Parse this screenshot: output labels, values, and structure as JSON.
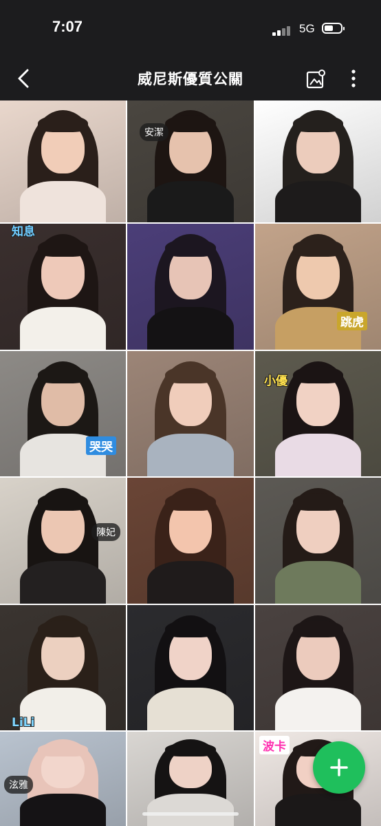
{
  "status_bar": {
    "time": "7:07",
    "network": "5G"
  },
  "header": {
    "title": "威尼斯優質公關",
    "back_icon": "chevron-left-icon",
    "album_icon": "photo-album-icon",
    "more_icon": "vertical-dots-icon"
  },
  "tiles": [
    {
      "bg": "#e9d7cc",
      "hair": "#2a1f1a",
      "skin": "#f1cdb8",
      "cloth": "#efe3dc"
    },
    {
      "bg": "#4a4640",
      "hair": "#1d1512",
      "skin": "#e6c2ad",
      "cloth": "#1a1a1a",
      "label": "安潔"
    },
    {
      "bg": "#ffffff",
      "hair": "#24201d",
      "skin": "#ecccbc",
      "cloth": "#1d1b1b"
    },
    {
      "bg": "#3a2f2e",
      "hair": "#1e1614",
      "skin": "#eec9b9",
      "cloth": "#f3f0ea",
      "sticker": "知息"
    },
    {
      "bg": "#4b3e78",
      "hair": "#1c1620",
      "skin": "#e7c4b6",
      "cloth": "#141214"
    },
    {
      "bg": "#c2a38a",
      "hair": "#2c211b",
      "skin": "#eec9ae",
      "cloth": "#c69f63",
      "sticker": "跳虎"
    },
    {
      "bg": "#8d8a86",
      "hair": "#1c1815",
      "skin": "#e0bca7",
      "cloth": "#e7e4e0",
      "sticker": "哭哭"
    },
    {
      "bg": "#9c8577",
      "hair": "#4a3528",
      "skin": "#f0cdbb",
      "cloth": "#a9b3bf"
    },
    {
      "bg": "#5d5a4e",
      "hair": "#1b1414",
      "skin": "#f1d2c4",
      "cloth": "#e9dbe5",
      "sticker": "小優"
    },
    {
      "bg": "#d8d2c9",
      "hair": "#181412",
      "skin": "#ecc7b3",
      "cloth": "#232020",
      "label": "陳妃"
    },
    {
      "bg": "#6a4536",
      "hair": "#3a2219",
      "skin": "#f3c5ad",
      "cloth": "#1f1b1b"
    },
    {
      "bg": "#5c5954",
      "hair": "#241b17",
      "skin": "#efcfc0",
      "cloth": "#6e7a5c"
    },
    {
      "bg": "#3a3430",
      "hair": "#2a2019",
      "skin": "#ecd0c0",
      "cloth": "#f2efe9",
      "sticker": "LiLi"
    },
    {
      "bg": "#2b2b2e",
      "hair": "#121012",
      "skin": "#f0d3c8",
      "cloth": "#e6e0d4"
    },
    {
      "bg": "#4a4240",
      "hair": "#1d1616",
      "skin": "#eccbbd",
      "cloth": "#f4f2ef"
    },
    {
      "bg": "#b9c3cf",
      "hair": "#e8c4b9",
      "skin": "#f2d6cc",
      "cloth": "#151315",
      "label": "泫雅"
    },
    {
      "bg": "#d9d6d2",
      "hair": "#151313",
      "skin": "#eed2c6",
      "cloth": "#dcd9d5"
    },
    {
      "bg": "#efe8e4",
      "hair": "#211917",
      "skin": "#f1d0c4",
      "cloth": "#1b1818",
      "sticker": "波卡"
    }
  ],
  "fab": {
    "icon": "plus-icon"
  }
}
